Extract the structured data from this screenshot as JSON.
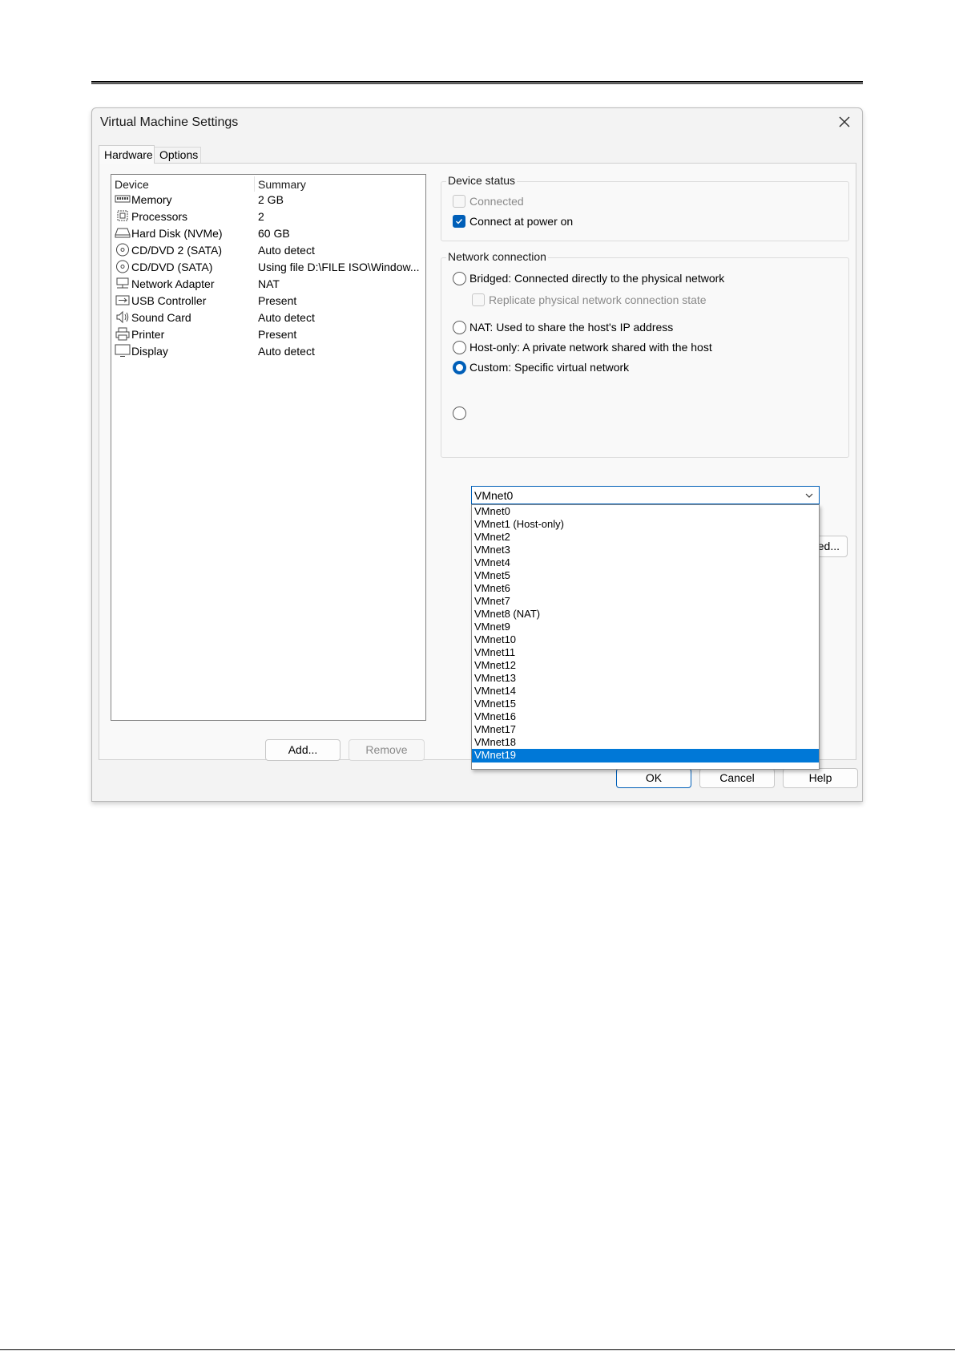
{
  "dialog": {
    "title": "Virtual Machine Settings",
    "tabs": [
      "Hardware",
      "Options"
    ]
  },
  "device_table": {
    "headers": [
      "Device",
      "Summary"
    ],
    "rows": [
      {
        "icon": "memory-icon",
        "name": "Memory",
        "summary": "2 GB"
      },
      {
        "icon": "processor-icon",
        "name": "Processors",
        "summary": "2"
      },
      {
        "icon": "hard-disk-icon",
        "name": "Hard Disk (NVMe)",
        "summary": "60 GB"
      },
      {
        "icon": "cd-dvd-icon",
        "name": "CD/DVD 2 (SATA)",
        "summary": "Auto detect"
      },
      {
        "icon": "cd-dvd-icon",
        "name": "CD/DVD (SATA)",
        "summary": "Using file D:\\FILE ISO\\Window..."
      },
      {
        "icon": "network-adapter-icon",
        "name": "Network Adapter",
        "summary": "NAT"
      },
      {
        "icon": "usb-icon",
        "name": "USB Controller",
        "summary": "Present"
      },
      {
        "icon": "speaker-icon",
        "name": "Sound Card",
        "summary": "Auto detect"
      },
      {
        "icon": "printer-icon",
        "name": "Printer",
        "summary": "Present"
      },
      {
        "icon": "display-icon",
        "name": "Display",
        "summary": "Auto detect"
      }
    ]
  },
  "list_buttons": {
    "add": "Add...",
    "remove": "Remove"
  },
  "device_status": {
    "legend": "Device status",
    "connected": {
      "label": "Connected",
      "checked": false,
      "enabled": false
    },
    "connect_at_power_on": {
      "label": "Connect at power on",
      "checked": true,
      "enabled": true
    }
  },
  "network_connection": {
    "legend": "Network connection",
    "bridged": "Bridged: Connected directly to the physical network",
    "replicate": "Replicate physical network connection state",
    "nat": "NAT: Used to share the host's IP address",
    "host_only": "Host-only: A private network shared with the host",
    "custom": "Custom: Specific virtual network",
    "selected_option": "custom",
    "custom_network_value": "VMnet0",
    "advanced_button_visible": "ed..."
  },
  "dropdown": {
    "options": [
      "VMnet0",
      "VMnet1 (Host-only)",
      "VMnet2",
      "VMnet3",
      "VMnet4",
      "VMnet5",
      "VMnet6",
      "VMnet7",
      "VMnet8 (NAT)",
      "VMnet9",
      "VMnet10",
      "VMnet11",
      "VMnet12",
      "VMnet13",
      "VMnet14",
      "VMnet15",
      "VMnet16",
      "VMnet17",
      "VMnet18",
      "VMnet19"
    ],
    "highlighted": "VMnet19"
  },
  "footer": {
    "ok": "OK",
    "cancel": "Cancel",
    "help": "Help"
  },
  "colors": {
    "accent": "#005fb8",
    "highlight": "#0078d7"
  }
}
